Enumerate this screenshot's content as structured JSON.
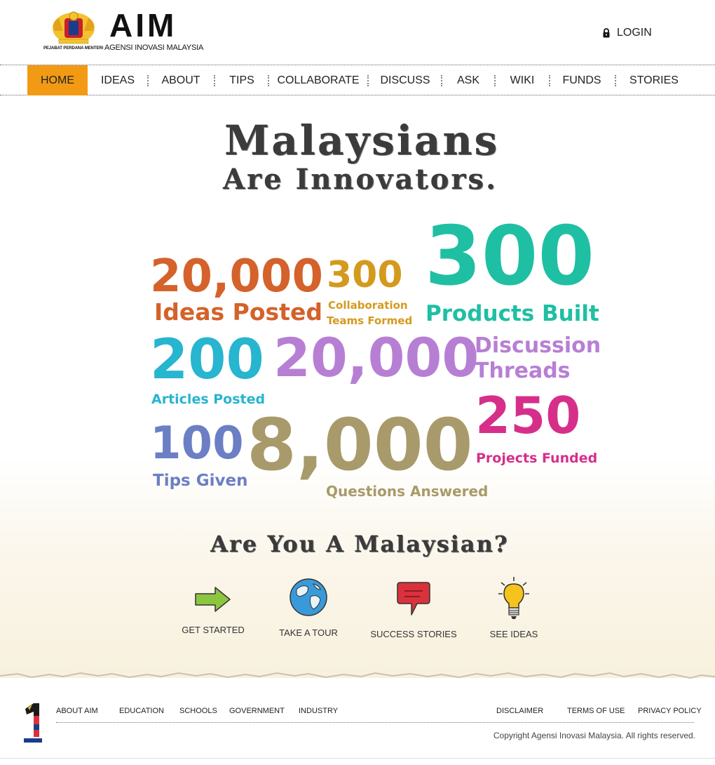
{
  "header": {
    "brand_title": "AIM",
    "brand_subtitle": "AGENSI INOVASI MALAYSIA",
    "crest_caption": "PEJABAT PERDANA MENTERI",
    "login_label": "LOGIN",
    "login_icon": "lock-icon"
  },
  "nav": {
    "items": [
      {
        "label": "HOME"
      },
      {
        "label": "IDEAS"
      },
      {
        "label": "ABOUT"
      },
      {
        "label": "TIPS"
      },
      {
        "label": "COLLABORATE"
      },
      {
        "label": "DISCUSS"
      },
      {
        "label": "ASK"
      },
      {
        "label": "WIKI"
      },
      {
        "label": "FUNDS"
      },
      {
        "label": "STORIES"
      }
    ],
    "active": "HOME",
    "active_color": "#f39a15"
  },
  "hero": {
    "title_line1": "Malaysians",
    "title_line2": "Are Innovators."
  },
  "stats": [
    {
      "value": "20,000",
      "label": "Ideas Posted",
      "color": "#d4622a"
    },
    {
      "value": "300",
      "label_line1": "Collaboration",
      "label_line2": "Teams Formed",
      "color": "#d49a1e"
    },
    {
      "value": "300",
      "label": "Products Built",
      "color": "#1fbfa4"
    },
    {
      "value": "200",
      "label": "Articles Posted",
      "color": "#27b5cf"
    },
    {
      "value": "20,000",
      "color": "#b77fd4"
    },
    {
      "label_line1": "Discussion",
      "label_line2": "Threads",
      "color": "#b77fd4"
    },
    {
      "value": "250",
      "label": "Projects Funded",
      "color": "#d62f8a"
    },
    {
      "value": "100",
      "label": "Tips Given",
      "color": "#6c7fc4"
    },
    {
      "value": "8,000",
      "label": "Questions Answered",
      "color": "#a89a6a"
    }
  ],
  "cta": {
    "question": "Are You A Malaysian?",
    "actions": [
      {
        "label": "GET STARTED",
        "icon": "arrow-right-icon"
      },
      {
        "label": "TAKE A TOUR",
        "icon": "globe-icon"
      },
      {
        "label": "SUCCESS STORIES",
        "icon": "speech-bubble-icon"
      },
      {
        "label": "SEE IDEAS",
        "icon": "lightbulb-icon"
      }
    ]
  },
  "footer": {
    "links_left": [
      "ABOUT AIM",
      "EDUCATION",
      "SCHOOLS",
      "GOVERNMENT",
      "INDUSTRY"
    ],
    "links_right": [
      "DISCLAIMER",
      "TERMS OF USE",
      "PRIVACY POLICY"
    ],
    "copyright": "Copyright Agensi Inovasi Malaysia. All rights reserved.",
    "logo_icon": "1malaysia-logo"
  }
}
